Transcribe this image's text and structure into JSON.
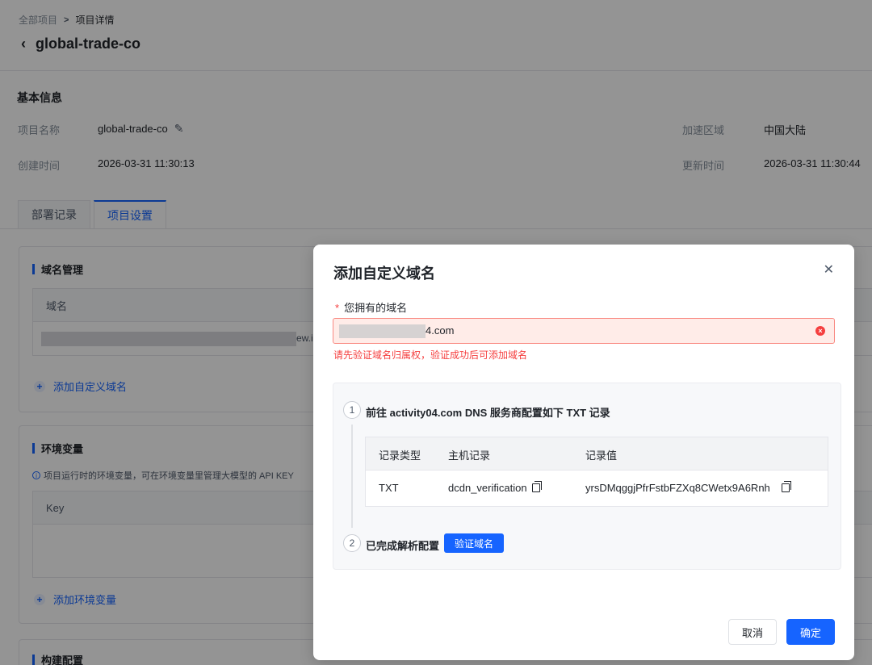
{
  "breadcrumb": {
    "root": "全部项目",
    "separator": ">",
    "current": "项目详情"
  },
  "project": {
    "title": "global-trade-co"
  },
  "basic_info": {
    "section_title": "基本信息",
    "name_label": "项目名称",
    "name_value": "global-trade-co",
    "region_label": "加速区域",
    "region_value": "中国大陆",
    "created_label": "创建时间",
    "created_value": "2026-03-31 11:30:13",
    "updated_label": "更新时间",
    "updated_value": "2026-03-31 11:30:44"
  },
  "tabs": [
    {
      "label": "部署记录"
    },
    {
      "label": "项目设置"
    }
  ],
  "domain_card": {
    "title": "域名管理",
    "column_header": "域名",
    "row_visible_text": "ew.i",
    "add_label": "添加自定义域名"
  },
  "env_card": {
    "title": "环境变量",
    "hint": "项目运行时的环境变量，可在环境变量里管理大模型的 API KEY",
    "column_header": "Key",
    "add_label": "添加环境变量"
  },
  "build_card": {
    "title": "构建配置"
  },
  "modal": {
    "title": "添加自定义域名",
    "close_icon": "close-icon",
    "field_label": "您拥有的域名",
    "required_mark": "*",
    "input_value_suffix": "4.com",
    "error_icon": "clear-error-icon",
    "error_text": "请先验证域名归属权，验证成功后可添加域名",
    "step1_num": "1",
    "step1_text": "前往 activity04.com DNS 服务商配置如下 TXT 记录",
    "dns_headers": {
      "type": "记录类型",
      "host": "主机记录",
      "value": "记录值"
    },
    "dns_row": {
      "type": "TXT",
      "host": "dcdn_verification",
      "value": "yrsDMqggjPfrFstbFZXq8CWetx9A6Rnh"
    },
    "step2_num": "2",
    "step2_text": "已完成解析配置",
    "verify_button": "验证域名",
    "cancel_button": "取消",
    "ok_button": "确定"
  },
  "colors": {
    "accent": "#1664ff",
    "error": "#f53f3f",
    "error_bg": "#ffece8",
    "overlay": "rgba(0,0,0,0.42)"
  }
}
